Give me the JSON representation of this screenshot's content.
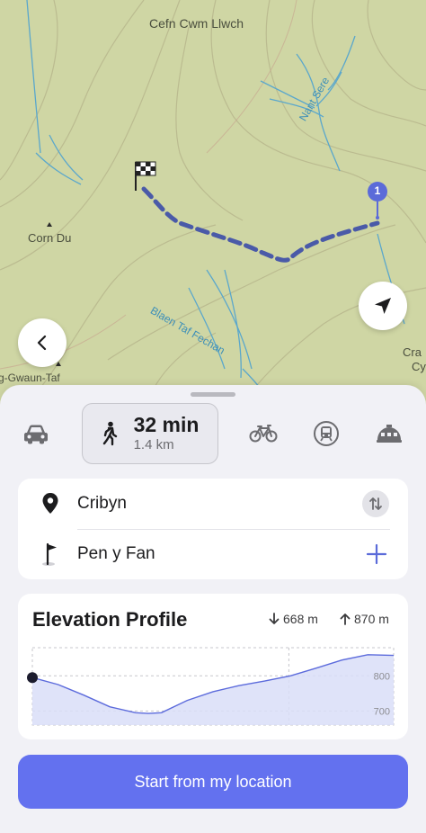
{
  "map": {
    "labels": {
      "cefn": "Cefn Cwm Llwch",
      "corn_du": "Corn Du",
      "nant_sere": "Nant Sere",
      "blaen_taf": "Blaen Taf Fechan",
      "gwaun_taf": "g-Gwaun-Taf",
      "cra": "Cra",
      "cy": "Cy"
    },
    "destination_pin_number": "1",
    "route_color": "#4a5aa8"
  },
  "modes": {
    "car_icon": "car-icon",
    "walk": {
      "icon": "walking-person-icon",
      "time": "32 min",
      "distance": "1.4 km"
    },
    "bike_icon": "bicycle-icon",
    "transit_icon": "train-icon",
    "cable_icon": "cable-car-icon"
  },
  "route": {
    "origin": "Cribyn",
    "destination": "Pen y Fan"
  },
  "elevation": {
    "title": "Elevation Profile",
    "descent": "668 m",
    "ascent": "870 m",
    "grid_labels": [
      "800",
      "700"
    ]
  },
  "chart_data": {
    "type": "area",
    "title": "Elevation Profile",
    "xlabel": "",
    "ylabel": "",
    "x": [
      0.0,
      0.1,
      0.2,
      0.3,
      0.4,
      0.45,
      0.5,
      0.6,
      0.7,
      0.8,
      0.9,
      1.0,
      1.1,
      1.2,
      1.3,
      1.4
    ],
    "values": [
      795,
      775,
      745,
      712,
      695,
      693,
      695,
      730,
      755,
      772,
      785,
      800,
      822,
      845,
      860,
      858
    ],
    "ylim": [
      660,
      880
    ],
    "yticks": [
      700,
      800
    ],
    "grid": true,
    "fill_color": "#d9def8",
    "line_color": "#5c6bdc"
  },
  "primary_action": "Start from my location",
  "colors": {
    "accent": "#6371ef",
    "map_bg": "#cfd6a4"
  }
}
